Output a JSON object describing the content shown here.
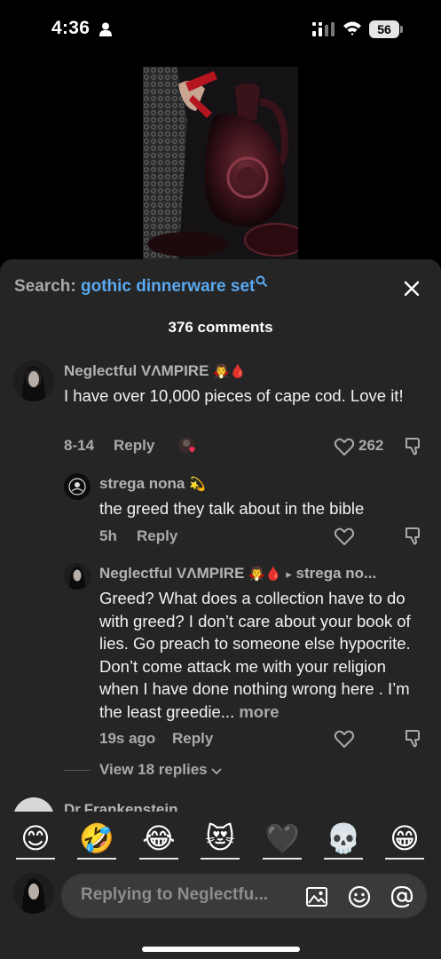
{
  "status_bar": {
    "time": "4:36",
    "battery": "56",
    "icons": [
      "person-icon",
      "signal-icon",
      "wifi-icon",
      "battery-icon"
    ]
  },
  "search": {
    "label": "Search: ",
    "term": "gothic dinnerware set"
  },
  "comments_count": "376 comments",
  "comments": [
    {
      "username": "Neglectful VΛMPIRE",
      "badges": [
        "🧛",
        "🩸"
      ],
      "text": "I have over 10,000 pieces of cape cod. Love it!",
      "date": "8-14",
      "reply_label": "Reply",
      "likes": "262"
    },
    {
      "username": "strega nona",
      "badges": [
        "💫"
      ],
      "text": "the greed they talk about in the bible",
      "date": "5h",
      "reply_label": "Reply"
    },
    {
      "username": "Neglectful VΛMPIRE",
      "badges": [
        "🧛",
        "🩸"
      ],
      "reply_to": "strega no...",
      "text": "Greed? What does a collection have to do with greed? I don’t care about your book of lies. Go preach to someone else hypocrite. Don’t come attack me with your religion when I have done nothing wrong here . I’m the least greedie...",
      "more_label": "more",
      "date": "19s ago",
      "reply_label": "Reply"
    }
  ],
  "view_replies": "View 18 replies",
  "next_comment_username": "Dr.Frankenstein",
  "emojis": [
    "😊",
    "🤣",
    "😂",
    "😻",
    "🖤",
    "💀",
    "😁"
  ],
  "input": {
    "placeholder": "Replying to Neglectfu..."
  },
  "colors": {
    "sheet_bg": "#252525",
    "search_term": "#5aa8f0",
    "blood_red": "#d4181e"
  }
}
